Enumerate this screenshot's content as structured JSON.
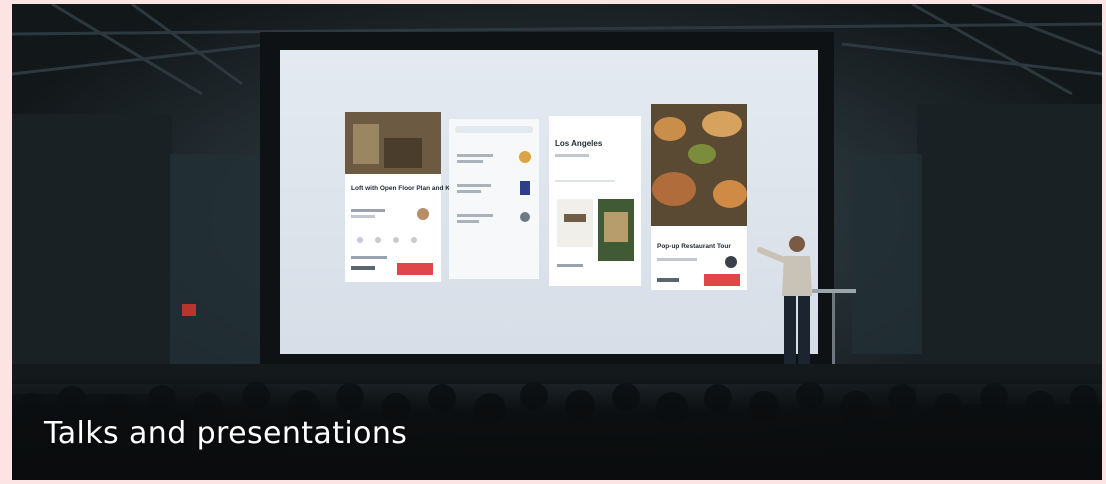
{
  "caption": "Talks and presentations",
  "colors": {
    "page_background": "#fbe4e3",
    "caption_text": "#ffffff",
    "accent_button": "#e0464a"
  },
  "screen": {
    "panel_1": {
      "title": "Loft with Open Floor Plan and Kitchen"
    },
    "panel_3": {
      "title": "Los Angeles"
    },
    "panel_4": {
      "title": "Pop-up Restaurant Tour"
    }
  }
}
